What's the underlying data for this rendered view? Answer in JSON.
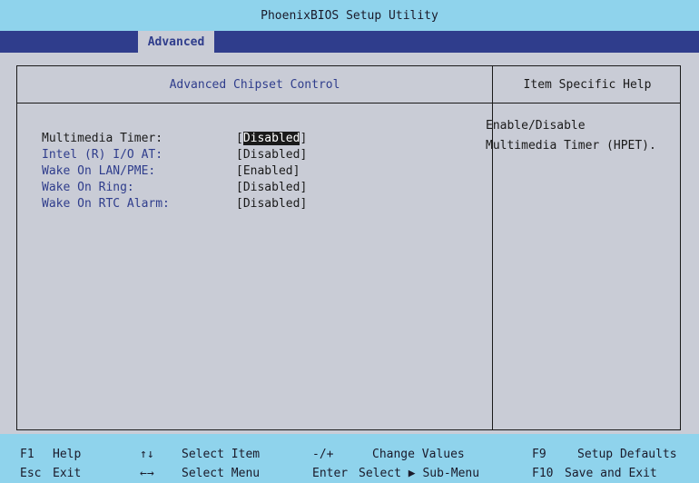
{
  "title": "PhoenixBIOS Setup Utility",
  "menu": {
    "active_tab": "Advanced"
  },
  "section_title": "Advanced Chipset Control",
  "help_title": "Item Specific Help",
  "help_text": [
    "Enable/Disable",
    "Multimedia Timer (HPET)."
  ],
  "settings": [
    {
      "label": "Multimedia Timer:",
      "value": "Disabled",
      "selected": true
    },
    {
      "label": "Intel (R) I/O AT:",
      "value": "Disabled",
      "selected": false
    },
    {
      "label": "Wake On LAN/PME:",
      "value": "Enabled",
      "selected": false
    },
    {
      "label": "Wake On Ring:",
      "value": "Disabled",
      "selected": false
    },
    {
      "label": "Wake On RTC Alarm:",
      "value": "Disabled",
      "selected": false
    }
  ],
  "footer": {
    "row1": [
      {
        "key": "F1",
        "action": "Help"
      },
      {
        "key": "↑↓",
        "action": "Select Item"
      },
      {
        "key": "-/+",
        "action": "Change Values"
      },
      {
        "key": "F9",
        "action": "Setup Defaults"
      }
    ],
    "row2": [
      {
        "key": "Esc",
        "action": "Exit"
      },
      {
        "key": "←→",
        "action": "Select Menu"
      },
      {
        "key": "Enter",
        "action": "Select ▶ Sub-Menu"
      },
      {
        "key": "F10",
        "action": "Save and Exit"
      }
    ]
  },
  "colors": {
    "background": "#8fd3ec",
    "menubar": "#2f3d8c",
    "panel": "#c9ccd6",
    "label": "#2f3d8c"
  }
}
